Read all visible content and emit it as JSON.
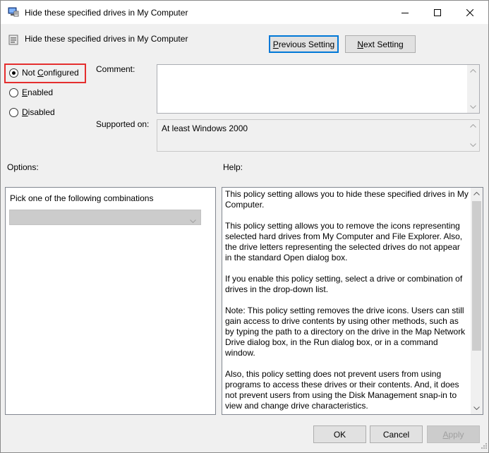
{
  "window": {
    "title": "Hide these specified drives in My Computer"
  },
  "header": {
    "title": "Hide these specified drives in My Computer",
    "previous_label": "Previous Setting",
    "previous_mnemonic": "P",
    "previous_rest": "revious Setting",
    "next_mnemonic": "N",
    "next_rest": "ext Setting"
  },
  "state": {
    "options": [
      {
        "label": "Not Configured",
        "pre": "Not ",
        "mnemonic": "C",
        "post": "onfigured",
        "checked": true
      },
      {
        "label": "Enabled",
        "pre": "",
        "mnemonic": "E",
        "post": "nabled",
        "checked": false
      },
      {
        "label": "Disabled",
        "pre": "",
        "mnemonic": "D",
        "post": "isabled",
        "checked": false
      }
    ]
  },
  "comment": {
    "label": "Comment:",
    "value": ""
  },
  "supported": {
    "label": "Supported on:",
    "value": "At least Windows 2000"
  },
  "options_panel": {
    "label": "Options:",
    "prompt": "Pick one of the following combinations",
    "dropdown_value": ""
  },
  "help": {
    "label": "Help:",
    "paragraphs": [
      "This policy setting allows you to hide these specified drives in My Computer.",
      "This policy setting allows you to remove the icons representing selected hard drives from My Computer and File Explorer. Also, the drive letters representing the selected drives do not appear in the standard Open dialog box.",
      "If you enable this policy setting, select a drive or combination of drives in the drop-down list.",
      "Note: This policy setting removes the drive icons. Users can still gain access to drive contents by using other methods, such as by typing the path to a directory on the drive in the Map Network Drive dialog box, in the Run dialog box, or in a command window.",
      "Also, this policy setting does not prevent users from using programs to access these drives or their contents. And, it does not prevent users from using the Disk Management snap-in to view and change drive characteristics."
    ]
  },
  "footer": {
    "ok": "OK",
    "cancel": "Cancel",
    "apply_mnemonic": "A",
    "apply_rest": "pply"
  },
  "colors": {
    "highlight": "#e52e2e",
    "focus": "#0078d7"
  },
  "icons": {
    "title": "policy-computer-icon",
    "header": "policy-setting-icon"
  }
}
